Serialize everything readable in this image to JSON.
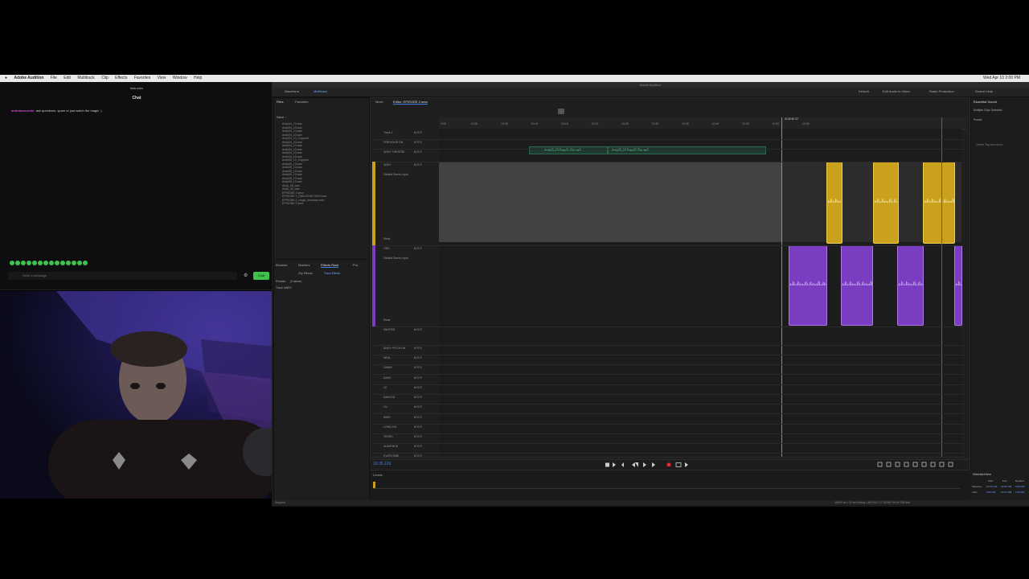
{
  "menubar": {
    "app_name": "Adobe Audition",
    "items": [
      "File",
      "Edit",
      "Multitrack",
      "Clip",
      "Effects",
      "Favorites",
      "View",
      "Window",
      "Help"
    ],
    "clock": "Wed Apr 10  2:00 PM"
  },
  "chat": {
    "site": "kick.com",
    "title": "Chat",
    "message_user": "antonioscomic:",
    "message_text": "ask questions, spam or just watch the magic :)",
    "input_placeholder": "Send a message",
    "send_label": "Chat"
  },
  "app": {
    "window_title": "Adobe Audition",
    "toolbar": {
      "waveform": "Waveform",
      "multitrack": "Multitrack",
      "default": "Default",
      "edit_audio_video": "Edit Audio to Video",
      "radio_production": "Radio Production",
      "search": "Search Help"
    },
    "files_panel": {
      "tab_files": "Files",
      "tab_favorites": "Favorites",
      "name_header": "Name ↑",
      "items": [
        "Andy04_13.wav",
        "Andy04_13.wav",
        "Andy04_13.wav",
        "Andy04_13.wav",
        "Andy04_13_Copyout",
        "Andy04_13.wav",
        "Andy04_13.wav",
        "Andy04_13.wav",
        "Andy04_13.wav",
        "Andy04_13.wav",
        "Andy05_13_Copyout",
        "Andy05_13.wav",
        "Andy05_13.wav",
        "Andy05_13.wav",
        "Andy05_13.wav",
        "Andy05_13.wav",
        "Andy05_13.wav",
        "Andy_05_wav",
        "Andy_05_wav",
        "EPISODE 2.sesx",
        "EPISODE 2_DIALOGUE ONLY.wav",
        "EPISODE 2_rough_mixdown.wav",
        "EPISODE 2.sesx"
      ]
    },
    "effects_panel": {
      "tab_browser": "Browser",
      "tab_markers": "Markers",
      "tab_effects_rack": "Effects Rack",
      "tab_props": "Pro",
      "sub_clip": "Clip Effects",
      "sub_track": "Track Effects",
      "presets_label": "Presets:",
      "presets_value": "(Custom)",
      "track_label": "Track: ANDY"
    },
    "editor": {
      "tab_mixer": "Mixer",
      "tab_editor": "Editor: EPISODE 2.sesx",
      "timecode": "10:35.126",
      "ruler_marks": [
        "9:55",
        "10:00",
        "10:05",
        "10:10",
        "10:15",
        "10:20",
        "10:25",
        "10:30",
        "10:35",
        "10:40",
        "10:45",
        "10:50",
        "10:55"
      ],
      "tracks": [
        {
          "name": "Track 1",
          "input": "",
          "read": ""
        },
        {
          "name": "PREVIOUS ON",
          "input": "",
          "read": ""
        },
        {
          "name": "ANDY THEATRE",
          "input": "",
          "read": ""
        },
        {
          "name": "ANDY",
          "input": "Default Stereo Input",
          "read": "Read"
        },
        {
          "name": "ORD",
          "input": "Default Stereo Input",
          "read": "Read"
        },
        {
          "name": "MASTER",
          "input": "",
          "read": ""
        },
        {
          "name": "ANDY PITCH DN",
          "input": "",
          "read": ""
        },
        {
          "name": "NEAL",
          "input": "",
          "read": ""
        },
        {
          "name": "DAWN",
          "input": "",
          "read": ""
        },
        {
          "name": "DANY",
          "input": "",
          "read": ""
        },
        {
          "name": "LE",
          "input": "",
          "read": ""
        },
        {
          "name": "DAKOTA",
          "input": "",
          "read": ""
        },
        {
          "name": "LN",
          "input": "",
          "read": ""
        },
        {
          "name": "MIKE",
          "input": "",
          "read": ""
        },
        {
          "name": "LONG-HO",
          "input": "",
          "read": ""
        },
        {
          "name": "TEENS",
          "input": "",
          "read": ""
        },
        {
          "name": "AUDIENCE",
          "input": "",
          "read": ""
        },
        {
          "name": "EVERYONE",
          "input": "",
          "read": ""
        }
      ],
      "theatre_clip_a": "Andy05_13.Copy01.Clip.mp3",
      "theatre_clip_b": "Andy05_13.Copy02.Clip.mp3",
      "marker": "SCENE 02"
    },
    "levels_label": "Levels",
    "right_panel": {
      "title": "Essential Sound",
      "subtitle": "Multiple Clips Selected",
      "preset": "Preset:",
      "none": "No Clip Selected",
      "tags": "Define Tag selections"
    },
    "selection_view": {
      "title": "Selection/View",
      "start": "Start",
      "end": "End",
      "duration": "Duration",
      "selection": "Selection",
      "view": "View",
      "sel_start": "10:35.126",
      "sel_end": "10:35.126",
      "sel_dur": "0:00.000",
      "view_start": "9:52.321",
      "view_end": "10:57.908",
      "view_dur": "1:05.587"
    },
    "status": {
      "left": "Stopped",
      "right": "48000 Hz • 32-bit Mixing   1.65 GB   1:17:33.962   46.50 GB free"
    }
  },
  "colors": {
    "clip_yellow": "#c9a11c",
    "clip_purple": "#7a3cc0",
    "accent_blue": "#3f7ee8",
    "chat_green": "#3ec24c"
  }
}
